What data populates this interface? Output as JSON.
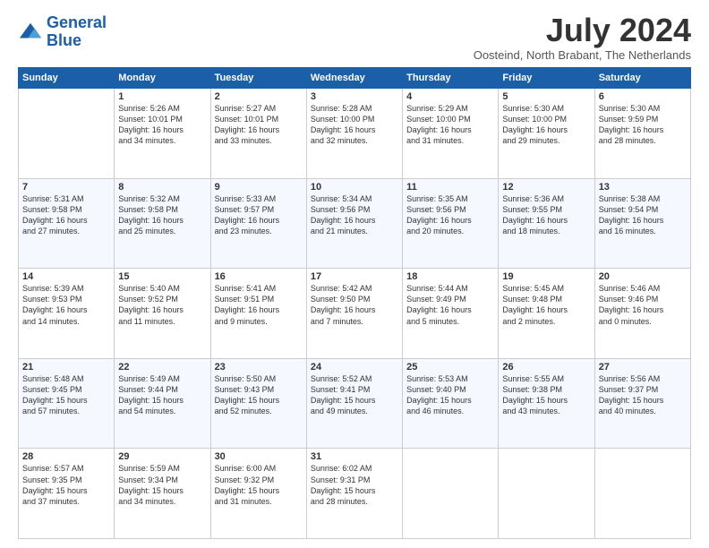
{
  "header": {
    "logo_line1": "General",
    "logo_line2": "Blue",
    "month": "July 2024",
    "location": "Oosteind, North Brabant, The Netherlands"
  },
  "weekdays": [
    "Sunday",
    "Monday",
    "Tuesday",
    "Wednesday",
    "Thursday",
    "Friday",
    "Saturday"
  ],
  "weeks": [
    [
      {
        "day": "",
        "info": ""
      },
      {
        "day": "1",
        "info": "Sunrise: 5:26 AM\nSunset: 10:01 PM\nDaylight: 16 hours\nand 34 minutes."
      },
      {
        "day": "2",
        "info": "Sunrise: 5:27 AM\nSunset: 10:01 PM\nDaylight: 16 hours\nand 33 minutes."
      },
      {
        "day": "3",
        "info": "Sunrise: 5:28 AM\nSunset: 10:00 PM\nDaylight: 16 hours\nand 32 minutes."
      },
      {
        "day": "4",
        "info": "Sunrise: 5:29 AM\nSunset: 10:00 PM\nDaylight: 16 hours\nand 31 minutes."
      },
      {
        "day": "5",
        "info": "Sunrise: 5:30 AM\nSunset: 10:00 PM\nDaylight: 16 hours\nand 29 minutes."
      },
      {
        "day": "6",
        "info": "Sunrise: 5:30 AM\nSunset: 9:59 PM\nDaylight: 16 hours\nand 28 minutes."
      }
    ],
    [
      {
        "day": "7",
        "info": "Sunrise: 5:31 AM\nSunset: 9:58 PM\nDaylight: 16 hours\nand 27 minutes."
      },
      {
        "day": "8",
        "info": "Sunrise: 5:32 AM\nSunset: 9:58 PM\nDaylight: 16 hours\nand 25 minutes."
      },
      {
        "day": "9",
        "info": "Sunrise: 5:33 AM\nSunset: 9:57 PM\nDaylight: 16 hours\nand 23 minutes."
      },
      {
        "day": "10",
        "info": "Sunrise: 5:34 AM\nSunset: 9:56 PM\nDaylight: 16 hours\nand 21 minutes."
      },
      {
        "day": "11",
        "info": "Sunrise: 5:35 AM\nSunset: 9:56 PM\nDaylight: 16 hours\nand 20 minutes."
      },
      {
        "day": "12",
        "info": "Sunrise: 5:36 AM\nSunset: 9:55 PM\nDaylight: 16 hours\nand 18 minutes."
      },
      {
        "day": "13",
        "info": "Sunrise: 5:38 AM\nSunset: 9:54 PM\nDaylight: 16 hours\nand 16 minutes."
      }
    ],
    [
      {
        "day": "14",
        "info": "Sunrise: 5:39 AM\nSunset: 9:53 PM\nDaylight: 16 hours\nand 14 minutes."
      },
      {
        "day": "15",
        "info": "Sunrise: 5:40 AM\nSunset: 9:52 PM\nDaylight: 16 hours\nand 11 minutes."
      },
      {
        "day": "16",
        "info": "Sunrise: 5:41 AM\nSunset: 9:51 PM\nDaylight: 16 hours\nand 9 minutes."
      },
      {
        "day": "17",
        "info": "Sunrise: 5:42 AM\nSunset: 9:50 PM\nDaylight: 16 hours\nand 7 minutes."
      },
      {
        "day": "18",
        "info": "Sunrise: 5:44 AM\nSunset: 9:49 PM\nDaylight: 16 hours\nand 5 minutes."
      },
      {
        "day": "19",
        "info": "Sunrise: 5:45 AM\nSunset: 9:48 PM\nDaylight: 16 hours\nand 2 minutes."
      },
      {
        "day": "20",
        "info": "Sunrise: 5:46 AM\nSunset: 9:46 PM\nDaylight: 16 hours\nand 0 minutes."
      }
    ],
    [
      {
        "day": "21",
        "info": "Sunrise: 5:48 AM\nSunset: 9:45 PM\nDaylight: 15 hours\nand 57 minutes."
      },
      {
        "day": "22",
        "info": "Sunrise: 5:49 AM\nSunset: 9:44 PM\nDaylight: 15 hours\nand 54 minutes."
      },
      {
        "day": "23",
        "info": "Sunrise: 5:50 AM\nSunset: 9:43 PM\nDaylight: 15 hours\nand 52 minutes."
      },
      {
        "day": "24",
        "info": "Sunrise: 5:52 AM\nSunset: 9:41 PM\nDaylight: 15 hours\nand 49 minutes."
      },
      {
        "day": "25",
        "info": "Sunrise: 5:53 AM\nSunset: 9:40 PM\nDaylight: 15 hours\nand 46 minutes."
      },
      {
        "day": "26",
        "info": "Sunrise: 5:55 AM\nSunset: 9:38 PM\nDaylight: 15 hours\nand 43 minutes."
      },
      {
        "day": "27",
        "info": "Sunrise: 5:56 AM\nSunset: 9:37 PM\nDaylight: 15 hours\nand 40 minutes."
      }
    ],
    [
      {
        "day": "28",
        "info": "Sunrise: 5:57 AM\nSunset: 9:35 PM\nDaylight: 15 hours\nand 37 minutes."
      },
      {
        "day": "29",
        "info": "Sunrise: 5:59 AM\nSunset: 9:34 PM\nDaylight: 15 hours\nand 34 minutes."
      },
      {
        "day": "30",
        "info": "Sunrise: 6:00 AM\nSunset: 9:32 PM\nDaylight: 15 hours\nand 31 minutes."
      },
      {
        "day": "31",
        "info": "Sunrise: 6:02 AM\nSunset: 9:31 PM\nDaylight: 15 hours\nand 28 minutes."
      },
      {
        "day": "",
        "info": ""
      },
      {
        "day": "",
        "info": ""
      },
      {
        "day": "",
        "info": ""
      }
    ]
  ]
}
